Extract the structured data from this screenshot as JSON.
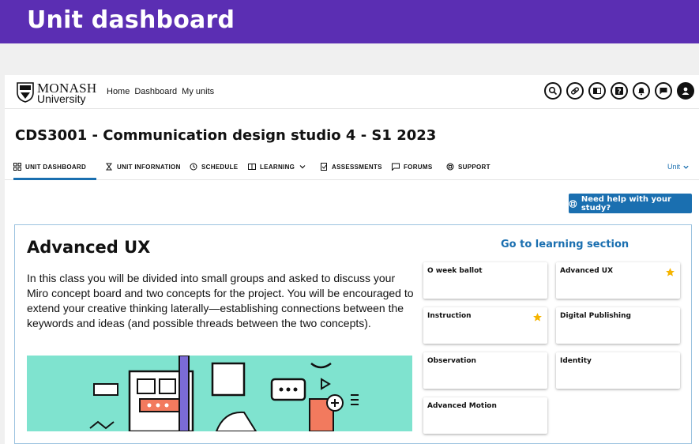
{
  "banner": {
    "title": "Unit dashboard"
  },
  "logo": {
    "line1": "MONASH",
    "line2": "University"
  },
  "topnav": {
    "links": [
      "Home",
      "Dashboard",
      "My units"
    ]
  },
  "top_icons": [
    "search-icon",
    "link-icon",
    "book-icon",
    "help-icon",
    "bell-icon",
    "chat-icon",
    "user-icon"
  ],
  "unit": {
    "title": "CDS3001 - Communication design studio 4 - S1 2023"
  },
  "tabs": [
    {
      "label": "UNIT DASHBOARD",
      "icon": "grid-icon"
    },
    {
      "label": "UNIT INFORNATION",
      "icon": "hourglass-icon"
    },
    {
      "label": "SCHEDULE",
      "icon": "clock-icon"
    },
    {
      "label": "LEARNING",
      "icon": "book-icon"
    },
    {
      "label": "ASSESSMENTS",
      "icon": "assessment-icon"
    },
    {
      "label": "FORUMS",
      "icon": "forum-icon"
    },
    {
      "label": "SUPPORT",
      "icon": "lifebuoy-icon"
    }
  ],
  "unit_menu": {
    "label": "Unit"
  },
  "help_button": {
    "label": "Need help with your study?"
  },
  "card": {
    "title": "Advanced UX",
    "description": "In this class you will be divided into small groups and asked to discuss your Miro concept board and two concepts for the project. You will be encouraged to extend your creative thinking laterally—establishing connections between the keywords and ideas (and possible threads between the two concepts).",
    "go_link": "Go to learning section",
    "tiles": [
      {
        "label": "O week ballot",
        "starred": false
      },
      {
        "label": "Advanced UX",
        "starred": true
      },
      {
        "label": "Instruction",
        "starred": true
      },
      {
        "label": "Digital Publishing",
        "starred": false
      },
      {
        "label": "Observation",
        "starred": false
      },
      {
        "label": "Identity",
        "starred": false
      },
      {
        "label": "Advanced Motion",
        "starred": false
      }
    ]
  },
  "colors": {
    "banner": "#5b2eb3",
    "accent": "#1a6fb0",
    "star": "#f5b400",
    "illustration": "#7fe3cf"
  }
}
